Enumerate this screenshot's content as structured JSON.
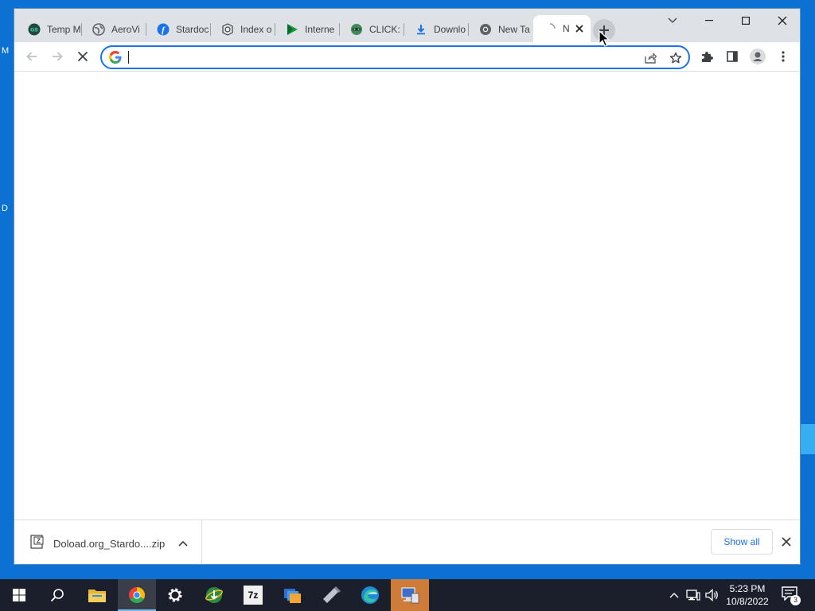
{
  "desktop": {
    "edge_glyph_1": "M",
    "edge_glyph_2": "D"
  },
  "browser": {
    "tabs": [
      {
        "title": "Temp M",
        "icon": "temp-mail-icon"
      },
      {
        "title": "AeroVi",
        "icon": "globe-icon"
      },
      {
        "title": "Stardoc",
        "icon": "stardock-icon"
      },
      {
        "title": "Index o",
        "icon": "index-icon"
      },
      {
        "title": "Interne",
        "icon": "play-icon"
      },
      {
        "title": "CLICK: ",
        "icon": "click-icon"
      },
      {
        "title": "Downlo",
        "icon": "download-icon"
      },
      {
        "title": "New Ta",
        "icon": "chrome-icon"
      },
      {
        "title": "N",
        "icon": "loading-icon",
        "active": true
      }
    ],
    "omnibox": {
      "value": "",
      "placeholder": ""
    },
    "download": {
      "filename": "Doload.org_Stardo....zip",
      "show_all_label": "Show all"
    },
    "colors": {
      "accent": "#1a73e8",
      "tabstrip": "#dee1e6",
      "taskbar": "#1b1f2b"
    }
  },
  "taskbar": {
    "apps": [
      "windows-start-icon",
      "search-icon",
      "file-explorer-icon",
      "chrome-icon",
      "settings-icon",
      "internet-download-manager-icon",
      "7zip-icon",
      "file-manager-icon",
      "usb-tool-icon",
      "edge-icon",
      "network-setup-icon"
    ],
    "seven_zip_label": "7z",
    "clock_time": "5:23 PM",
    "clock_date": "10/8/2022",
    "notification_count": "3"
  }
}
